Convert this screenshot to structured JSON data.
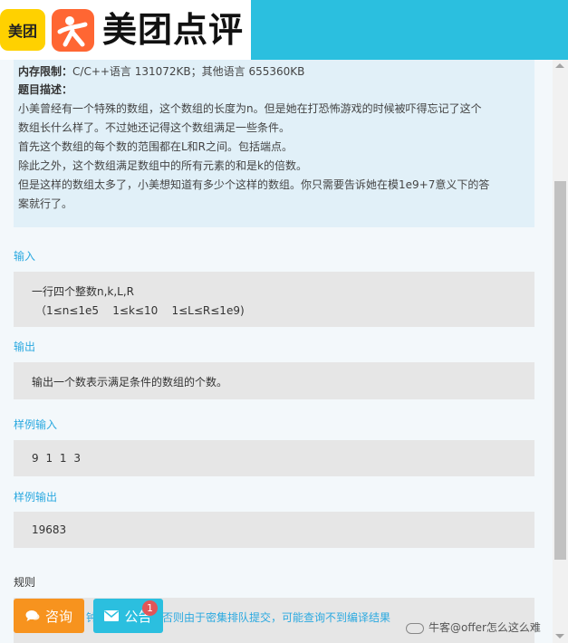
{
  "header": {
    "logo_small": "美团",
    "brand": "美团点评"
  },
  "problem": {
    "memory_label": "内存限制：",
    "memory_value": "C/C++语言 131072KB；其他语言 655360KB",
    "desc_label": "题目描述：",
    "desc_lines": [
      "小美曾经有一个特殊的数组，这个数组的长度为n。但是她在打恐怖游戏的时候被吓得忘记了这个",
      "数组长什么样了。不过她还记得这个数组满足一些条件。",
      "首先这个数组的每个数的范围都在L和R之间。包括端点。",
      "除此之外，这个数组满足数组中的所有元素的和是k的倍数。",
      "但是这样的数组太多了，小美想知道有多少个这样的数组。你只需要告诉她在模1e9+7意义下的答",
      "案就行了。"
    ]
  },
  "input": {
    "label": "输入",
    "lines": [
      "一行四个整数n,k,L,R",
      "（1≤n≤1e5    1≤k≤10    1≤L≤R≤1e9)"
    ]
  },
  "output": {
    "label": "输出",
    "text": "输出一个数表示满足条件的数组的个数。"
  },
  "sample_input": {
    "label": "样例输入",
    "text": "9 1 1 3"
  },
  "sample_output": {
    "label": "样例输出",
    "text": "19683"
  },
  "rules": {
    "label": "规则",
    "text": "钟前调试程序，否则由于密集排队提交，可能查询不到编译结果"
  },
  "buttons": {
    "consult": "咨询",
    "notice": "公告",
    "notice_badge": "1"
  },
  "watermark": "牛客@offer怎么这么难",
  "colors": {
    "header_bg": "#2bbfdf",
    "accent": "#2ba9e0",
    "consult_btn": "#f7931e",
    "badge": "#e15558"
  }
}
